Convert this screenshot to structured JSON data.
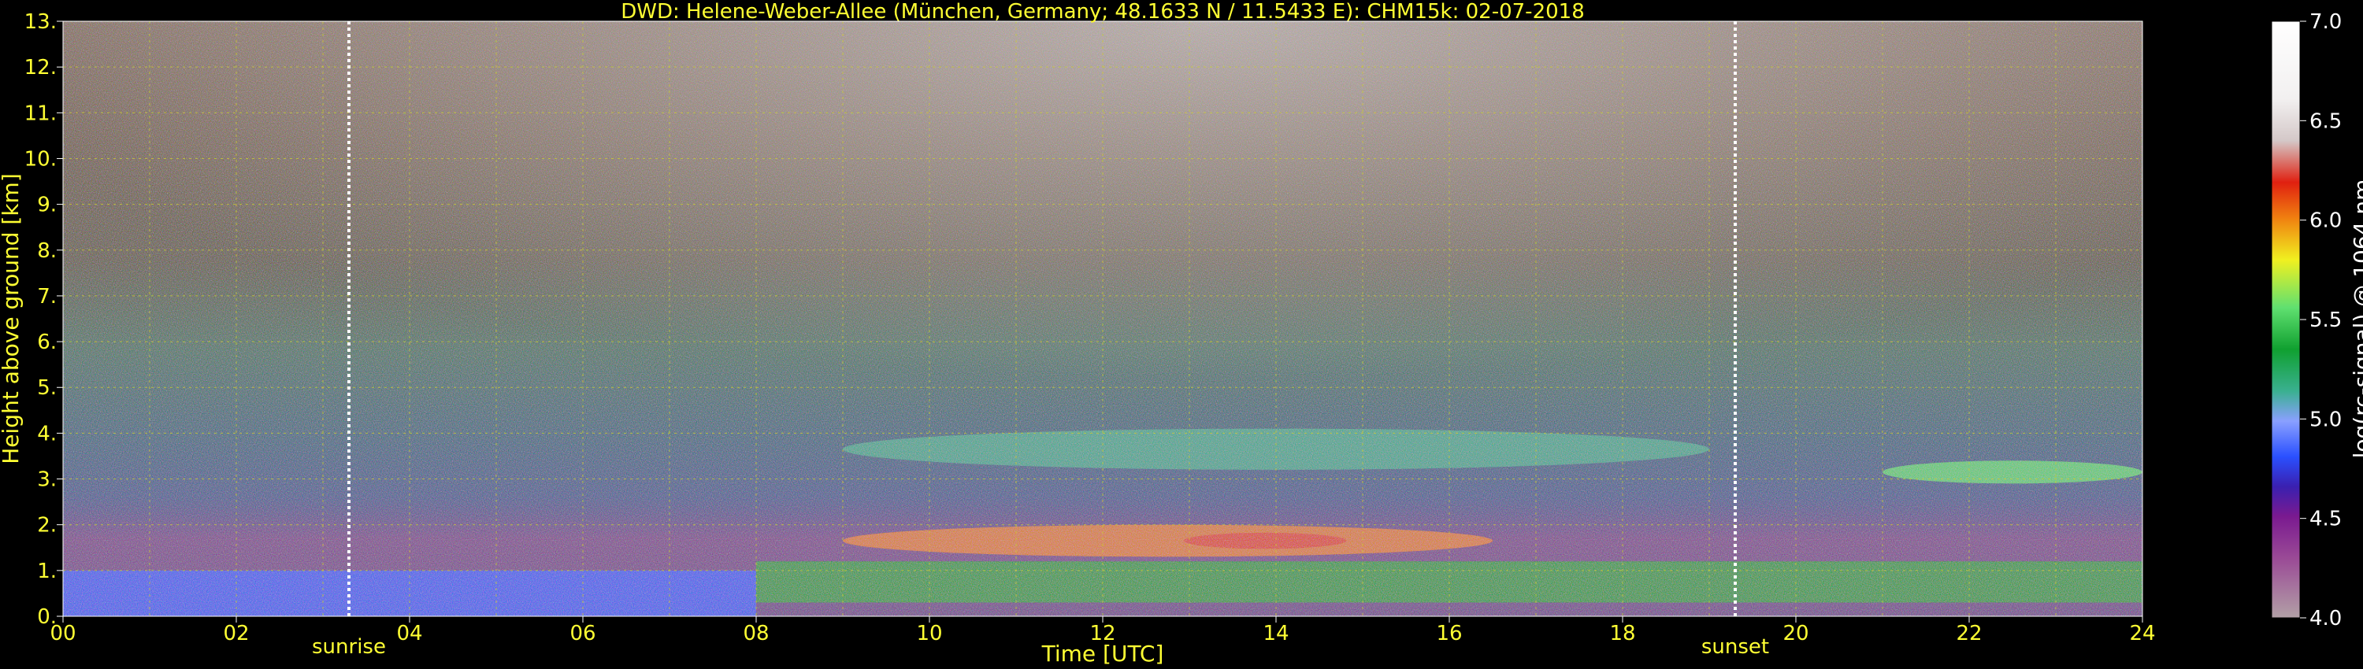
{
  "chart_data": {
    "type": "heatmap",
    "title": "DWD: Helene-Weber-Allee (München, Germany; 48.1633 N / 11.5433 E):    CHM15k: 02-07-2018",
    "xlabel": "Time [UTC]",
    "ylabel": "Height above ground [km]",
    "xlim": [
      0,
      24
    ],
    "ylim": [
      0,
      13
    ],
    "x_ticks": [
      "00",
      "02",
      "04",
      "06",
      "08",
      "10",
      "12",
      "14",
      "16",
      "18",
      "20",
      "22",
      "24"
    ],
    "y_ticks": [
      "0.",
      "1.",
      "2.",
      "3.",
      "4.",
      "5.",
      "6.",
      "7.",
      "8.",
      "9.",
      "10.",
      "11.",
      "12.",
      "13."
    ],
    "grid": true,
    "colorbar": {
      "label": "log(rc-signal) @ 1064 nm",
      "range": [
        4.0,
        7.0
      ],
      "ticks": [
        "4.0",
        "4.5",
        "5.0",
        "5.5",
        "6.0",
        "6.5",
        "7.0"
      ]
    },
    "markers": [
      {
        "label": "sunrise",
        "x": 3.3
      },
      {
        "label": "sunset",
        "x": 19.3
      }
    ],
    "features": [
      {
        "kind": "boundary layer (blue)",
        "x": [
          0,
          8
        ],
        "y": [
          0,
          1.0
        ],
        "level": 4.9
      },
      {
        "kind": "mixed layer (green)",
        "x": [
          8,
          24
        ],
        "y": [
          0.3,
          1.2
        ],
        "level": 5.3
      },
      {
        "kind": "aerosol layer (yellow-red core)",
        "x": [
          9,
          16.5
        ],
        "y": [
          1.3,
          2.0
        ],
        "level": 5.7
      },
      {
        "kind": "elevated aerosol layer (green)",
        "x": [
          9,
          19
        ],
        "y": [
          3.2,
          4.1
        ],
        "level": 5.2
      },
      {
        "kind": "night-time layer (yellow)",
        "x": [
          21,
          24
        ],
        "y": [
          2.9,
          3.4
        ],
        "level": 5.5
      }
    ]
  }
}
